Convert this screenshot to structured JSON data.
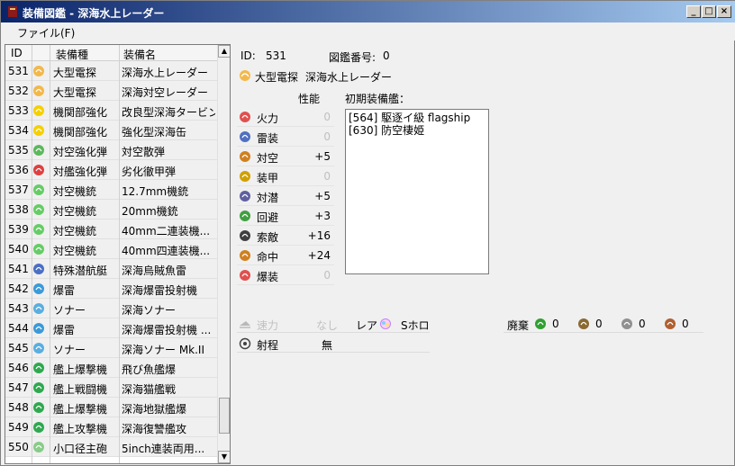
{
  "window": {
    "title": "装備図鑑 - 深海水上レーダー"
  },
  "menu": {
    "file": "ファイル(F)"
  },
  "list": {
    "headers": [
      "ID",
      "装備種",
      "装備名"
    ],
    "rows": [
      {
        "id": "531",
        "type": "大型電探",
        "name": "深海水上レーダー",
        "icon": "radar-icon",
        "color": "#f2b84b"
      },
      {
        "id": "532",
        "type": "大型電探",
        "name": "深海対空レーダー",
        "icon": "radar-icon",
        "color": "#f2b84b"
      },
      {
        "id": "533",
        "type": "機関部強化",
        "name": "改良型深海タービン",
        "icon": "engine-icon",
        "color": "#f5d000"
      },
      {
        "id": "534",
        "type": "機関部強化",
        "name": "強化型深海缶",
        "icon": "engine-icon",
        "color": "#f5d000"
      },
      {
        "id": "535",
        "type": "対空強化弾",
        "name": "対空散弾",
        "icon": "aa-shell-icon",
        "color": "#5cb85c"
      },
      {
        "id": "536",
        "type": "対艦強化弾",
        "name": "劣化徹甲弾",
        "icon": "ap-shell-icon",
        "color": "#e04040"
      },
      {
        "id": "537",
        "type": "対空機銃",
        "name": "12.7mm機銃",
        "icon": "aa-gun-icon",
        "color": "#66cc66"
      },
      {
        "id": "538",
        "type": "対空機銃",
        "name": "20mm機銃",
        "icon": "aa-gun-icon",
        "color": "#66cc66"
      },
      {
        "id": "539",
        "type": "対空機銃",
        "name": "40mm二連装機...",
        "icon": "aa-gun-icon",
        "color": "#66cc66"
      },
      {
        "id": "540",
        "type": "対空機銃",
        "name": "40mm四連装機...",
        "icon": "aa-gun-icon",
        "color": "#66cc66"
      },
      {
        "id": "541",
        "type": "特殊潜航艇",
        "name": "深海烏賊魚雷",
        "icon": "submarine-icon",
        "color": "#4a6fc4"
      },
      {
        "id": "542",
        "type": "爆雷",
        "name": "深海爆雷投射機",
        "icon": "depth-charge-icon",
        "color": "#3a9ad9"
      },
      {
        "id": "543",
        "type": "ソナー",
        "name": "深海ソナー",
        "icon": "sonar-icon",
        "color": "#5aaee0"
      },
      {
        "id": "544",
        "type": "爆雷",
        "name": "深海爆雷投射機 ...",
        "icon": "depth-charge-icon",
        "color": "#3a9ad9"
      },
      {
        "id": "545",
        "type": "ソナー",
        "name": "深海ソナー Mk.II",
        "icon": "sonar-icon",
        "color": "#5aaee0"
      },
      {
        "id": "546",
        "type": "艦上爆撃機",
        "name": "飛び魚艦爆",
        "icon": "dive-bomber-icon",
        "color": "#2fa84f"
      },
      {
        "id": "547",
        "type": "艦上戦闘機",
        "name": "深海猫艦戦",
        "icon": "fighter-icon",
        "color": "#2fa84f"
      },
      {
        "id": "548",
        "type": "艦上爆撃機",
        "name": "深海地獄艦爆",
        "icon": "dive-bomber-icon",
        "color": "#2fa84f"
      },
      {
        "id": "549",
        "type": "艦上攻撃機",
        "name": "深海復讐艦攻",
        "icon": "torpedo-bomber-icon",
        "color": "#2fa84f"
      },
      {
        "id": "550",
        "type": "小口径主砲",
        "name": "5inch連装両用...",
        "icon": "small-gun-icon",
        "color": "#88cc88"
      }
    ]
  },
  "detail": {
    "id_label": "ID:",
    "id_value": "531",
    "album_label": "図鑑番号:",
    "album_value": "0",
    "type": "大型電探",
    "name": "深海水上レーダー",
    "stats_header": "性能",
    "stats": [
      {
        "name": "火力",
        "value": "0",
        "dim": true,
        "icon": "firepower-icon",
        "color": "#e05050"
      },
      {
        "name": "雷装",
        "value": "0",
        "dim": true,
        "icon": "torpedo-icon",
        "color": "#5070c0"
      },
      {
        "name": "対空",
        "value": "+5",
        "dim": false,
        "icon": "anti-air-icon",
        "color": "#d08020"
      },
      {
        "name": "装甲",
        "value": "0",
        "dim": true,
        "icon": "armor-icon",
        "color": "#d0a000"
      },
      {
        "name": "対潜",
        "value": "+5",
        "dim": false,
        "icon": "asw-icon",
        "color": "#6060a0"
      },
      {
        "name": "回避",
        "value": "+3",
        "dim": false,
        "icon": "evasion-icon",
        "color": "#40a040"
      },
      {
        "name": "索敵",
        "value": "+16",
        "dim": false,
        "icon": "los-icon",
        "color": "#404040"
      },
      {
        "name": "命中",
        "value": "+24",
        "dim": false,
        "icon": "accuracy-icon",
        "color": "#d08020"
      },
      {
        "name": "爆装",
        "value": "0",
        "dim": true,
        "icon": "bombing-icon",
        "color": "#e05050"
      }
    ],
    "initial_label": "初期装備艦：",
    "initial_ships": [
      "[564] 駆逐イ級 flagship",
      "[630] 防空棲姫"
    ],
    "speed_label": "速力",
    "speed_value": "なし",
    "range_label": "射程",
    "range_value": "無",
    "rarity_label": "レア",
    "rarity_value": "Sホロ",
    "scrap_label": "廃棄",
    "scrap": [
      {
        "icon": "fuel-icon",
        "value": "0",
        "color": "#30a030"
      },
      {
        "icon": "ammo-icon",
        "value": "0",
        "color": "#8a6a30"
      },
      {
        "icon": "steel-icon",
        "value": "0",
        "color": "#909090"
      },
      {
        "icon": "bauxite-icon",
        "value": "0",
        "color": "#b06030"
      }
    ]
  }
}
